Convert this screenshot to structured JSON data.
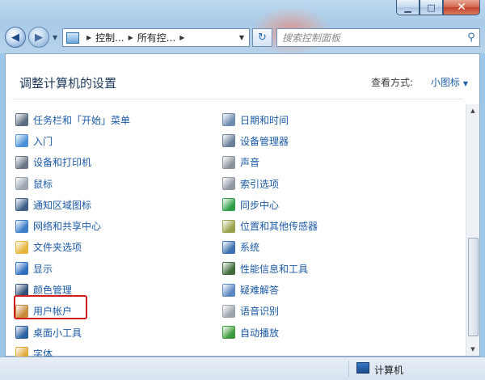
{
  "window": {
    "buttons": {
      "minimize": "▁",
      "maximize": "□",
      "close": "✕"
    }
  },
  "nav": {
    "back_glyph": "◀",
    "forward_glyph": "▶",
    "dropdown_glyph": "▼",
    "breadcrumbs": [
      "控制...",
      "所有控..."
    ],
    "separator": "▶",
    "address_dropdown_glyph": "▼",
    "refresh_glyph": "↻"
  },
  "search": {
    "placeholder": "搜索控制面板",
    "icon": "search-icon",
    "glyph": "⚲"
  },
  "header": {
    "title": "调整计算机的设置",
    "view_by_label": "查看方式:",
    "view_by_value": "小图标",
    "view_caret": "▼"
  },
  "left_items": [
    {
      "label": "任务栏和「开始」菜单",
      "icon": "taskbar-icon",
      "color": "#5a6a7f"
    },
    {
      "label": "入门",
      "icon": "getting-started-icon",
      "color": "#4a90d9"
    },
    {
      "label": "设备和打印机",
      "icon": "printer-icon",
      "color": "#6b7788"
    },
    {
      "label": "鼠标",
      "icon": "mouse-icon",
      "color": "#9aa4b0"
    },
    {
      "label": "通知区域图标",
      "icon": "notification-area-icon",
      "color": "#3d5f8a"
    },
    {
      "label": "网络和共享中心",
      "icon": "network-icon",
      "color": "#3a7cc8"
    },
    {
      "label": "文件夹选项",
      "icon": "folder-options-icon",
      "color": "#e6b43a"
    },
    {
      "label": "显示",
      "icon": "display-icon",
      "color": "#2e6fbf"
    },
    {
      "label": "颜色管理",
      "icon": "color-management-icon",
      "color": "#2f4f78"
    },
    {
      "label": "用户帐户",
      "icon": "user-accounts-icon",
      "color": "#c98a3c"
    },
    {
      "label": "桌面小工具",
      "icon": "desktop-gadgets-icon",
      "color": "#2a5fa0"
    },
    {
      "label": "字体",
      "icon": "fonts-icon",
      "color": "#e0a93a"
    }
  ],
  "right_items": [
    {
      "label": "日期和时间",
      "icon": "clock-icon",
      "color": "#6f8bb0"
    },
    {
      "label": "设备管理器",
      "icon": "device-manager-icon",
      "color": "#6b7f99"
    },
    {
      "label": "声音",
      "icon": "speaker-icon",
      "color": "#8c939c"
    },
    {
      "label": "索引选项",
      "icon": "indexing-icon",
      "color": "#9098a3"
    },
    {
      "label": "同步中心",
      "icon": "sync-icon",
      "color": "#2fa048"
    },
    {
      "label": "位置和其他传感器",
      "icon": "sensor-icon",
      "color": "#9aa24a"
    },
    {
      "label": "系统",
      "icon": "system-icon",
      "color": "#3b6fb0"
    },
    {
      "label": "性能信息和工具",
      "icon": "performance-icon",
      "color": "#3d6b3a"
    },
    {
      "label": "疑难解答",
      "icon": "troubleshooting-icon",
      "color": "#5b87c2"
    },
    {
      "label": "语音识别",
      "icon": "microphone-icon",
      "color": "#9ca3ad"
    },
    {
      "label": "自动播放",
      "icon": "autoplay-icon",
      "color": "#3c9a3c"
    }
  ],
  "scrollbar": {
    "up_glyph": "▲",
    "down_glyph": "▼"
  },
  "status_bar": {
    "label": "计算机",
    "icon": "computer-icon"
  },
  "highlight_color": "#d21b1b"
}
